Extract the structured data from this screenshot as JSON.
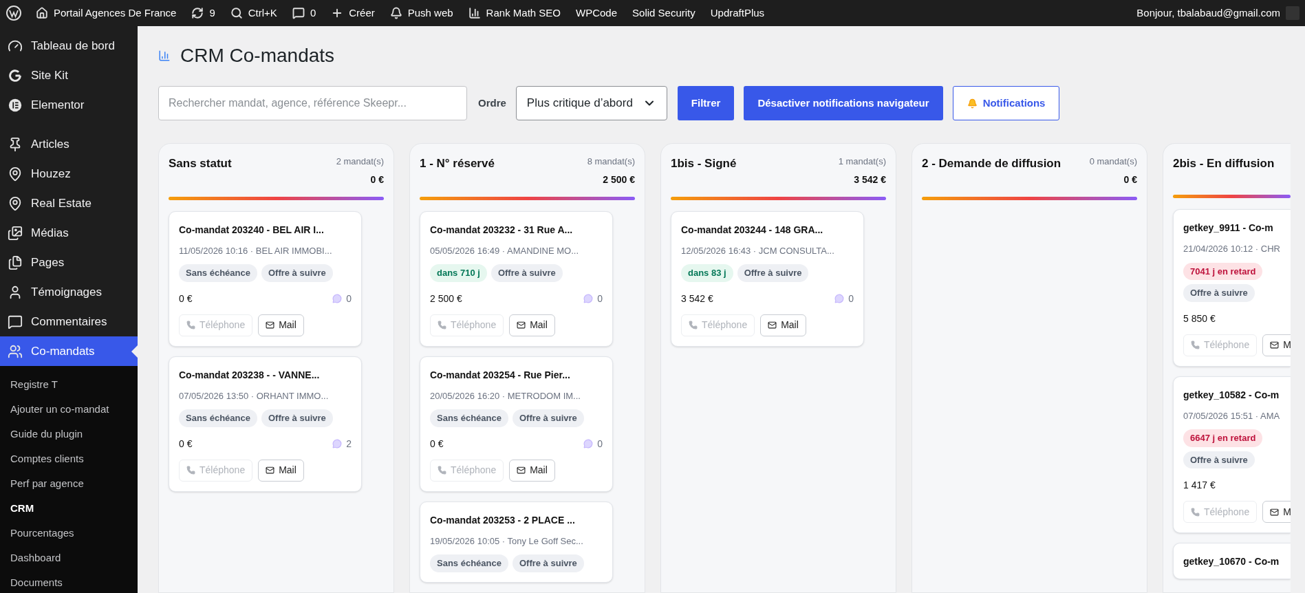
{
  "admin_bar": {
    "items": [
      {
        "label": "Portail Agences De France"
      },
      {
        "label": "9"
      },
      {
        "label": "Ctrl+K"
      },
      {
        "label": "0"
      },
      {
        "label": "Créer"
      },
      {
        "label": "Push web"
      },
      {
        "label": "Rank Math SEO"
      },
      {
        "label": "WPCode"
      },
      {
        "label": "Solid Security"
      },
      {
        "label": "UpdraftPlus"
      }
    ],
    "greeting": "Bonjour, tbalabaud@gmail.com"
  },
  "sidebar": {
    "groups": [
      [
        {
          "label": "Tableau de bord",
          "selected": false
        },
        {
          "label": "Site Kit",
          "selected": false
        },
        {
          "label": "Elementor",
          "selected": false
        }
      ],
      [
        {
          "label": "Articles",
          "selected": false
        },
        {
          "label": "Houzez",
          "selected": false
        },
        {
          "label": "Real Estate",
          "selected": false
        },
        {
          "label": "Médias",
          "selected": false
        },
        {
          "label": "Pages",
          "selected": false
        },
        {
          "label": "Témoignages",
          "selected": false
        },
        {
          "label": "Commentaires",
          "selected": false
        },
        {
          "label": "Co-mandats",
          "selected": true
        }
      ]
    ],
    "submenu": [
      {
        "label": "Registre T",
        "selected": false
      },
      {
        "label": "Ajouter un co-mandat",
        "selected": false
      },
      {
        "label": "Guide du plugin",
        "selected": false
      },
      {
        "label": "Comptes clients",
        "selected": false
      },
      {
        "label": "Perf par agence",
        "selected": false
      },
      {
        "label": "CRM",
        "selected": true
      },
      {
        "label": "Pourcentages",
        "selected": false
      },
      {
        "label": "Dashboard",
        "selected": false
      },
      {
        "label": "Documents",
        "selected": false
      }
    ]
  },
  "page": {
    "title": "CRM Co-mandats"
  },
  "filters": {
    "search": {
      "placeholder": "Rechercher mandat, agence, référence Skeepr..."
    },
    "order_label": "Ordre",
    "order_value": "Plus critique d’abord",
    "filter_button": "Filtrer",
    "disable_button": "Désactiver notifications navigateur",
    "notifications_button": "Notifications"
  },
  "columns": [
    {
      "title": "Sans statut",
      "count": "2 mandat(s)",
      "total": "0 €",
      "cards": [
        {
          "title": "Co-mandat 203240 - BEL AIR I...",
          "meta": "11/05/2026 10:16 · BEL AIR IMMOBI...",
          "tags": [
            {
              "label": "Sans échéance",
              "kind": "neutral"
            },
            {
              "label": "Offre à suivre",
              "kind": "neutral"
            }
          ],
          "amount": "0 €",
          "comments": "0",
          "phone": {
            "label": "Téléphone",
            "disabled": true
          },
          "mail": {
            "label": "Mail",
            "disabled": false
          }
        },
        {
          "title": "Co-mandat 203238 - - VANNE...",
          "meta": "07/05/2026 13:50 · ORHANT IMMO...",
          "tags": [
            {
              "label": "Sans échéance",
              "kind": "neutral"
            },
            {
              "label": "Offre à suivre",
              "kind": "neutral"
            }
          ],
          "amount": "0 €",
          "comments": "2",
          "phone": {
            "label": "Téléphone",
            "disabled": true
          },
          "mail": {
            "label": "Mail",
            "disabled": false
          }
        }
      ]
    },
    {
      "title": "1 - N° réservé",
      "count": "8 mandat(s)",
      "total": "2 500 €",
      "cards": [
        {
          "title": "Co-mandat 203232 - 31 Rue A...",
          "meta": "05/05/2026 16:49 · AMANDINE MO...",
          "tags": [
            {
              "label": "dans 710 j",
              "kind": "due"
            },
            {
              "label": "Offre à suivre",
              "kind": "neutral"
            }
          ],
          "amount": "2 500 €",
          "comments": "0",
          "phone": {
            "label": "Téléphone",
            "disabled": true
          },
          "mail": {
            "label": "Mail",
            "disabled": false
          }
        },
        {
          "title": "Co-mandat 203254 - Rue Pier...",
          "meta": "20/05/2026 16:20 · METRODOM IM...",
          "tags": [
            {
              "label": "Sans échéance",
              "kind": "neutral"
            },
            {
              "label": "Offre à suivre",
              "kind": "neutral"
            }
          ],
          "amount": "0 €",
          "comments": "0",
          "phone": {
            "label": "Téléphone",
            "disabled": true
          },
          "mail": {
            "label": "Mail",
            "disabled": false
          }
        },
        {
          "title": "Co-mandat 203253 - 2 PLACE ...",
          "meta": "19/05/2026 10:05 · Tony Le Goff Sec...",
          "tags": [
            {
              "label": "Sans échéance",
              "kind": "neutral"
            },
            {
              "label": "Offre à suivre",
              "kind": "neutral"
            }
          ]
        }
      ]
    },
    {
      "title": "1bis - Signé",
      "count": "1 mandat(s)",
      "total": "3 542 €",
      "cards": [
        {
          "title": "Co-mandat 203244 - 148 GRA...",
          "meta": "12/05/2026 16:43 · JCM CONSULTA...",
          "tags": [
            {
              "label": "dans 83 j",
              "kind": "due"
            },
            {
              "label": "Offre à suivre",
              "kind": "neutral"
            }
          ],
          "amount": "3 542 €",
          "comments": "0",
          "phone": {
            "label": "Téléphone",
            "disabled": true
          },
          "mail": {
            "label": "Mail",
            "disabled": false
          }
        }
      ]
    },
    {
      "title": "2 - Demande de diffusion",
      "count": "0 mandat(s)",
      "total": "0 €"
    },
    {
      "title": "2bis - En diffusion",
      "cards": [
        {
          "title": "getkey_9911 - Co-m",
          "meta": "21/04/2026 10:12 · CHR",
          "tags": [
            {
              "label": "7041 j en retard",
              "kind": "overdue"
            },
            {
              "label": "Offre à suivre",
              "kind": "neutral"
            }
          ],
          "amount": "5 850 €",
          "phone": {
            "label": "Téléphone",
            "disabled": true
          },
          "mail": {
            "label": "M",
            "disabled": false
          }
        },
        {
          "title": "getkey_10582 - Co-m",
          "meta": "07/05/2026 15:51 · AMA",
          "tags": [
            {
              "label": "6647 j en retard",
              "kind": "overdue"
            },
            {
              "label": "Offre à suivre",
              "kind": "neutral"
            }
          ],
          "amount": "1 417 €",
          "phone": {
            "label": "Téléphone",
            "disabled": true
          },
          "mail": {
            "label": "M",
            "disabled": false
          }
        },
        {
          "title": "getkey_10670 - Co-m"
        }
      ]
    }
  ]
}
